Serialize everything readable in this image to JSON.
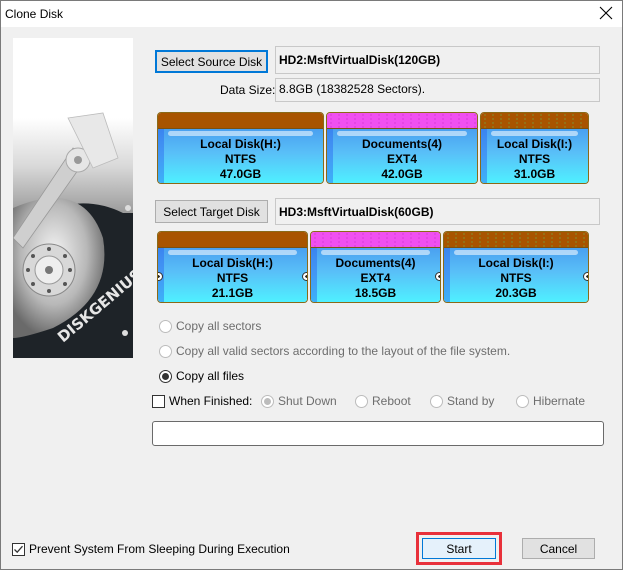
{
  "window": {
    "title": "Clone Disk",
    "close_icon": "close-icon"
  },
  "side_image": {
    "brand": "DISKGENIUS",
    "icon": "hard-disk-illustration"
  },
  "source": {
    "button_label": "Select Source Disk",
    "disk_name": "HD2:MsftVirtualDisk(120GB)",
    "data_size_label": "Data Size:",
    "data_size_value": "8.8GB (18382528 Sectors).",
    "partitions": [
      {
        "name": "Local Disk(H:)",
        "fs": "NTFS",
        "size": "47.0GB",
        "top_color": "#a85400",
        "size_gb": 47.0
      },
      {
        "name": "Documents(4)",
        "fs": "EXT4",
        "size": "42.0GB",
        "top_color": "#f050f0",
        "size_gb": 42.0
      },
      {
        "name": "Local Disk(I:)",
        "fs": "NTFS",
        "size": "31.0GB",
        "top_color": "#a85400",
        "size_gb": 31.0
      }
    ]
  },
  "target": {
    "button_label": "Select Target Disk",
    "disk_name": "HD3:MsftVirtualDisk(60GB)",
    "partitions": [
      {
        "name": "Local Disk(H:)",
        "fs": "NTFS",
        "size": "21.1GB",
        "top_color": "#a85400",
        "size_gb": 21.1
      },
      {
        "name": "Documents(4)",
        "fs": "EXT4",
        "size": "18.5GB",
        "top_color": "#f050f0",
        "size_gb": 18.5
      },
      {
        "name": "Local Disk(I:)",
        "fs": "NTFS",
        "size": "20.3GB",
        "top_color": "#a85400",
        "size_gb": 20.3
      }
    ]
  },
  "copy_modes": [
    {
      "label": "Copy all sectors",
      "selected": false,
      "enabled": false
    },
    {
      "label": "Copy all valid sectors according to the layout of the file system.",
      "selected": false,
      "enabled": false
    },
    {
      "label": "Copy all files",
      "selected": true,
      "enabled": true
    }
  ],
  "when_finished": {
    "label": "When Finished:",
    "checked": false,
    "options": [
      {
        "label": "Shut Down",
        "selected": true
      },
      {
        "label": "Reboot",
        "selected": false
      },
      {
        "label": "Stand by",
        "selected": false
      },
      {
        "label": "Hibernate",
        "selected": false
      }
    ]
  },
  "progress": {
    "value": 0
  },
  "footer": {
    "prevent_sleep_label": "Prevent System From Sleeping During Execution",
    "prevent_sleep_checked": true,
    "start_label": "Start",
    "cancel_label": "Cancel",
    "highlight_color": "#e8303a"
  }
}
